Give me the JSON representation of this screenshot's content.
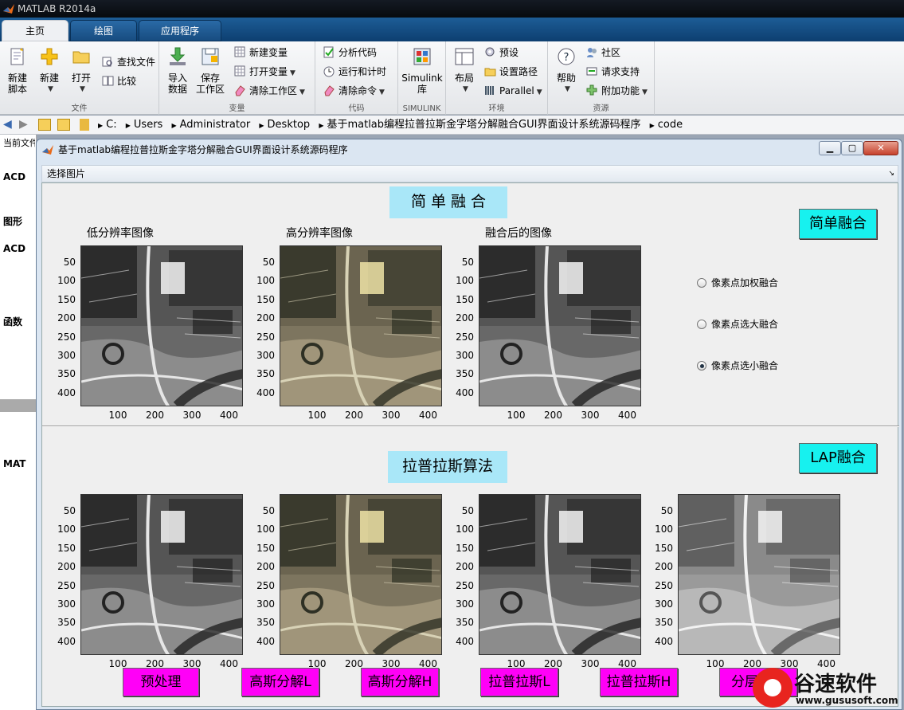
{
  "app": {
    "title": "MATLAB R2014a"
  },
  "tabs": [
    {
      "label": "主页"
    },
    {
      "label": "绘图"
    },
    {
      "label": "应用程序"
    }
  ],
  "ribbon": {
    "file": {
      "label": "文件",
      "new_script": "新建\n脚本",
      "new": "新建",
      "open": "打开",
      "find_files": "查找文件",
      "compare": "比较"
    },
    "variable": {
      "label": "变量",
      "import": "导入\n数据",
      "save_ws": "保存\n工作区",
      "new_var": "新建变量",
      "open_var": "打开变量",
      "clear_ws": "清除工作区"
    },
    "code": {
      "label": "代码",
      "analyze": "分析代码",
      "run_time": "运行和计时",
      "clear_cmd": "清除命令"
    },
    "simulink": {
      "label": "SIMULINK",
      "lib": "Simulink\n库"
    },
    "env": {
      "label": "环境",
      "layout": "布局",
      "prefs": "预设",
      "set_path": "设置路径",
      "parallel": "Parallel"
    },
    "resources": {
      "label": "资源",
      "help": "帮助",
      "community": "社区",
      "support": "请求支持",
      "addons": "附加功能"
    }
  },
  "address": {
    "crumbs": [
      "C:",
      "Users",
      "Administrator",
      "Desktop",
      "基于matlab编程拉普拉斯金字塔分解融合GUI界面设计系统源码程序",
      "code"
    ]
  },
  "left_panel": {
    "header": "当前文件",
    "items": [
      "ACD",
      "图形",
      "ACD",
      "函数",
      "MAT"
    ]
  },
  "figure": {
    "title": "基于matlab编程拉普拉斯金字塔分解融合GUI界面设计系统源码程序",
    "menu": "选择图片",
    "simple_header": "简 单 融 合",
    "lap_header": "拉普拉斯算法",
    "labels": {
      "low": "低分辨率图像",
      "high": "高分辨率图像",
      "fused": "融合后的图像"
    },
    "buttons": {
      "simple": "简单融合",
      "lap": "LAP融合",
      "pre": "预处理",
      "gauss_l": "高斯分解L",
      "gauss_h": "高斯分解H",
      "lap_l": "拉普拉斯L",
      "lap_h": "拉普拉斯H",
      "split": "分层融合"
    },
    "radios": [
      {
        "label": "像素点加权融合",
        "checked": false
      },
      {
        "label": "像素点选大融合",
        "checked": false
      },
      {
        "label": "像素点选小融合",
        "checked": true
      }
    ],
    "yticks": [
      "50",
      "100",
      "150",
      "200",
      "250",
      "300",
      "350",
      "400"
    ],
    "xticks": [
      "100",
      "200",
      "300",
      "400"
    ]
  },
  "watermark": {
    "text": "谷速软件",
    "url": "www.gususoft.com"
  }
}
